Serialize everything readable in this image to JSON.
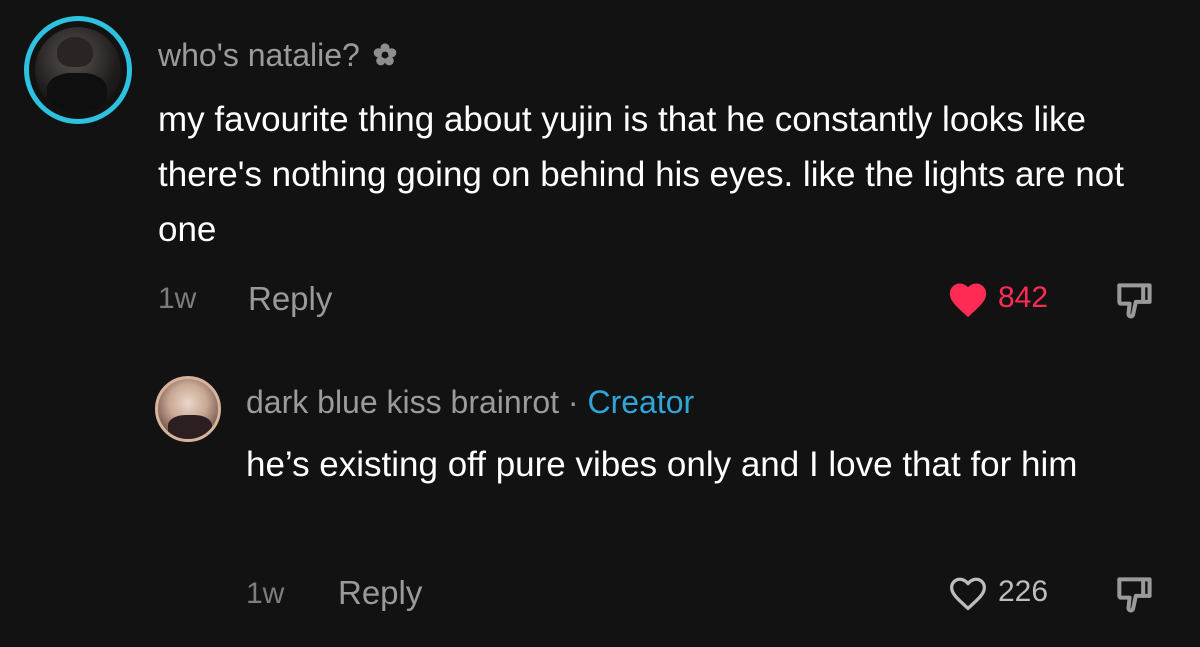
{
  "colors": {
    "background": "#121212",
    "avatar_ring": "#2cc2e0",
    "like_active": "#fe2c55",
    "creator_tag": "#2fa6d8"
  },
  "comment": {
    "username": "who's natalie?",
    "username_icon": "flower-icon",
    "text": "my favourite thing about yujin is that he constantly looks like there's nothing going on behind his eyes. like the lights are not one",
    "time": "1w",
    "reply_label": "Reply",
    "likes": "842",
    "liked": true,
    "like_icon": "heart-filled-icon",
    "dislike_icon": "thumbs-down-icon"
  },
  "reply": {
    "username": "dark blue kiss brainrot",
    "separator": " · ",
    "badge": "Creator",
    "text": "he’s existing off pure vibes only and I love that for him",
    "time": "1w",
    "reply_label": "Reply",
    "likes": "226",
    "liked": false,
    "like_icon": "heart-outline-icon",
    "dislike_icon": "thumbs-down-icon"
  }
}
